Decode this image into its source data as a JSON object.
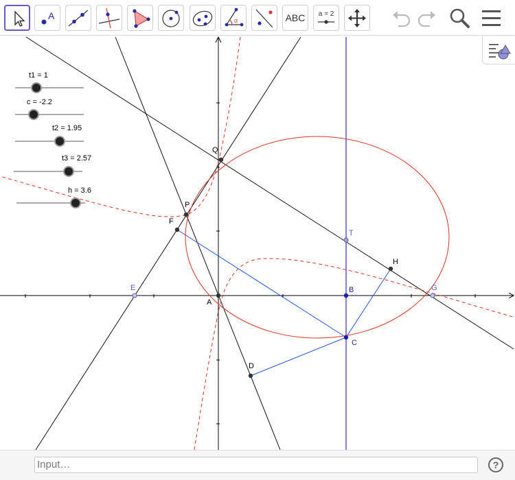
{
  "toolbar": {
    "tools": [
      {
        "name": "move-tool",
        "active": true
      },
      {
        "name": "point-tool",
        "glyph": "A"
      },
      {
        "name": "line-tool"
      },
      {
        "name": "perpendicular-line-tool"
      },
      {
        "name": "polygon-tool"
      },
      {
        "name": "circle-tool"
      },
      {
        "name": "ellipse-tool"
      },
      {
        "name": "angle-tool",
        "glyph": "α"
      },
      {
        "name": "reflect-tool"
      },
      {
        "name": "text-tool",
        "label": "ABC"
      },
      {
        "name": "slider-tool",
        "label": "a = 2"
      },
      {
        "name": "move-graphics-view-tool"
      }
    ],
    "undo_icon": "undo-icon",
    "redo_icon": "redo-icon",
    "search_icon": "search-icon",
    "menu_icon": "hamburger-menu-icon"
  },
  "sliders": [
    {
      "label": "t1 = 1",
      "value": 1
    },
    {
      "label": "c = -2.2",
      "value": -2.2
    },
    {
      "label": "t2 = 1.95",
      "value": 1.95
    },
    {
      "label": "t3 = 2.57",
      "value": 2.57
    },
    {
      "label": "h = 3.6",
      "value": 3.6
    }
  ],
  "points": [
    {
      "label": "Q"
    },
    {
      "label": "P"
    },
    {
      "label": "F"
    },
    {
      "label": "T"
    },
    {
      "label": "H"
    },
    {
      "label": "E"
    },
    {
      "label": "A"
    },
    {
      "label": "B"
    },
    {
      "label": "G"
    },
    {
      "label": "C"
    },
    {
      "label": "D"
    }
  ],
  "colors": {
    "conic": "#e03020",
    "segments": "#2255e0",
    "vertical_line": "#5555dd",
    "point": "#333333",
    "free_point": "#5a5ac8",
    "accent": "#6557d2"
  },
  "input": {
    "placeholder": "Input…"
  },
  "help": {
    "label": "?"
  }
}
